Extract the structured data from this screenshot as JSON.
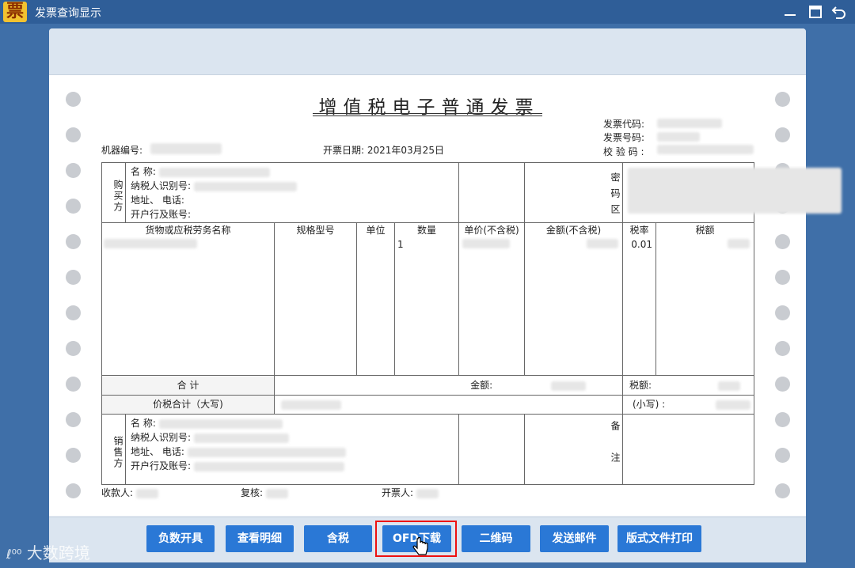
{
  "window": {
    "title": "发票查询显示",
    "app_icon_char": "票"
  },
  "invoice": {
    "title": "增值税电子普通发票",
    "machine_no_label": "机器编号:",
    "date_label": "开票日期:",
    "date_value": "2021年03月25日",
    "code_label": "发票代码:",
    "number_label": "发票号码:",
    "check_label": "校 验 码 :",
    "buyer": {
      "side_label": "购买方",
      "name_label": "名        称:",
      "taxid_label": "纳税人识别号:",
      "addr_label": "地址、  电话:",
      "bank_label": "开户行及账号:"
    },
    "password_label": "密码区",
    "columns": [
      "货物或应税劳务名称",
      "规格型号",
      "单位",
      "数量",
      "单价(不含税)",
      "金额(不含税)",
      "税率",
      "税额"
    ],
    "row": {
      "qty": "1",
      "rate": "0.01"
    },
    "total_label": "合        计",
    "amount_label": "金额:",
    "tax_label": "税额:",
    "total_tax_label": "价税合计（大写)",
    "small_label": "(小写)  :",
    "seller": {
      "side_label": "销售方",
      "name_label": "名        称:",
      "taxid_label": "纳税人识别号:",
      "addr_label": "地址、  电话:",
      "bank_label": "开户行及账号:"
    },
    "remark_label": "备注",
    "payee_label": "收款人:",
    "reviewer_label": "复核:",
    "issuer_label": "开票人:"
  },
  "buttons": [
    "负数开具",
    "查看明细",
    "含税",
    "OFD下载",
    "二维码",
    "发送邮件",
    "版式文件打印"
  ],
  "watermark": "大数跨境",
  "colors": {
    "titlebar": "#2f5e98",
    "button": "#2a78d6",
    "highlight": "#e11111",
    "app_icon": "#f2c230"
  }
}
